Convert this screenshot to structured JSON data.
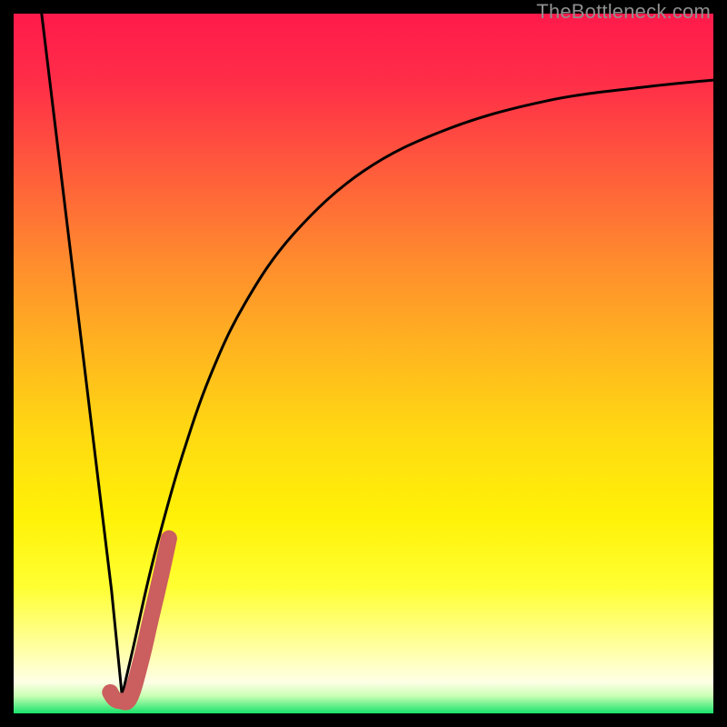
{
  "watermark": "TheBottleneck.com",
  "gradient": {
    "stops": [
      {
        "offset": 0.0,
        "color": "#ff1a4b"
      },
      {
        "offset": 0.1,
        "color": "#ff2e48"
      },
      {
        "offset": 0.22,
        "color": "#ff5a3c"
      },
      {
        "offset": 0.35,
        "color": "#ff8a2e"
      },
      {
        "offset": 0.48,
        "color": "#ffb51f"
      },
      {
        "offset": 0.6,
        "color": "#ffd912"
      },
      {
        "offset": 0.72,
        "color": "#fff207"
      },
      {
        "offset": 0.82,
        "color": "#ffff33"
      },
      {
        "offset": 0.9,
        "color": "#ffff9a"
      },
      {
        "offset": 0.955,
        "color": "#ffffe6"
      },
      {
        "offset": 0.975,
        "color": "#c9ffb4"
      },
      {
        "offset": 1.0,
        "color": "#17e36b"
      }
    ]
  },
  "chart_data": {
    "type": "line",
    "title": "",
    "xlabel": "",
    "ylabel": "",
    "xlim": [
      0,
      100
    ],
    "ylim": [
      0,
      100
    ],
    "series": [
      {
        "name": "curve-left",
        "x": [
          4.0,
          6.0,
          8.0,
          10.0,
          12.0,
          14.0,
          15.5
        ],
        "y": [
          100.0,
          83.5,
          67.0,
          50.5,
          34.0,
          17.5,
          2.5
        ]
      },
      {
        "name": "curve-right",
        "x": [
          15.5,
          17.0,
          19.0,
          21.0,
          24.0,
          28.0,
          33.0,
          40.0,
          50.0,
          62.0,
          76.0,
          90.0,
          100.0
        ],
        "y": [
          2.5,
          9.0,
          18.0,
          26.0,
          36.5,
          48.0,
          58.5,
          68.5,
          77.5,
          83.5,
          87.5,
          89.5,
          90.5
        ]
      },
      {
        "name": "marker-stroke",
        "x": [
          13.8,
          14.4,
          15.2,
          16.6,
          18.2,
          19.6,
          21.0,
          22.2
        ],
        "y": [
          3.0,
          2.1,
          1.8,
          2.2,
          7.5,
          13.5,
          19.5,
          25.0
        ]
      }
    ]
  }
}
